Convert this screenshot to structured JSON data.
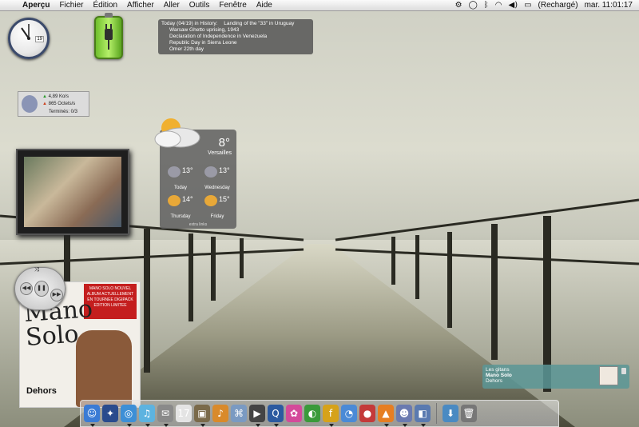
{
  "menubar": {
    "app_name": "Aperçu",
    "items": [
      "Fichier",
      "Édition",
      "Afficher",
      "Aller",
      "Outils",
      "Fenêtre",
      "Aide"
    ],
    "battery_status": "(Rechargé)",
    "clock": "mar. 11:01:17"
  },
  "history_widget": {
    "header": "Today (04/19) in History:",
    "events": [
      "Landing of the \"33\" in Uruguay",
      "Warsaw Ghetto uprising, 1943",
      "Declaration of Independence in Venezuela",
      "Republic Day in Sierra Leone",
      "Omer 22th day"
    ]
  },
  "clock_widget": {
    "date_badge": "19"
  },
  "net_monitor": {
    "download": "4,89 Ko/s",
    "upload": "865 Octets/s",
    "finished": "Terminés: 0/3"
  },
  "weather": {
    "temp": "8°",
    "city": "Versailles",
    "forecast": [
      {
        "temp": "13°",
        "day": "Today",
        "icon": "rain-icon"
      },
      {
        "temp": "13°",
        "day": "Wednesday",
        "icon": "rain-icon"
      },
      {
        "temp": "14°",
        "day": "Thursday",
        "icon": "sun-cloud-icon"
      },
      {
        "temp": "15°",
        "day": "Friday",
        "icon": "sun-cloud-icon"
      }
    ],
    "extra": "extra links"
  },
  "album": {
    "artist": "Mano Solo",
    "title": "Dehors",
    "band_text": "MANO SOLO NOUVEL ALBUM ACTUELLEMENT EN TOURNEE DIGIPACK EDITION LIMITEE"
  },
  "now_playing": {
    "track": "Les gitans",
    "artist": "Mano Solo",
    "album": "Dehors"
  },
  "dock": {
    "items": [
      {
        "name": "finder",
        "glyph": "☺",
        "color": "#3a7bd5"
      },
      {
        "name": "dashboard",
        "glyph": "✦",
        "color": "#2a4b8d"
      },
      {
        "name": "safari",
        "glyph": "◎",
        "color": "#3d8fd6"
      },
      {
        "name": "itunes",
        "glyph": "♫",
        "color": "#5db3e0"
      },
      {
        "name": "mail",
        "glyph": "✉",
        "color": "#8a8a8a"
      },
      {
        "name": "ical",
        "glyph": "17",
        "color": "#e4e4e4"
      },
      {
        "name": "iphoto",
        "glyph": "▣",
        "color": "#7a6a4a"
      },
      {
        "name": "garageband",
        "glyph": "♪",
        "color": "#d98a2a"
      },
      {
        "name": "network",
        "glyph": "⌘",
        "color": "#7a9ac2"
      },
      {
        "name": "imovie",
        "glyph": "▶",
        "color": "#444"
      },
      {
        "name": "quicktime",
        "glyph": "Q",
        "color": "#2c5aa0"
      },
      {
        "name": "flower",
        "glyph": "✿",
        "color": "#d44a9a"
      },
      {
        "name": "dreamweaver",
        "glyph": "◐",
        "color": "#3a9a3a"
      },
      {
        "name": "flash",
        "glyph": "f",
        "color": "#d6a21a"
      },
      {
        "name": "ichat",
        "glyph": "◔",
        "color": "#4a8ad6"
      },
      {
        "name": "colorsync",
        "glyph": "●",
        "color": "#c43a3a"
      },
      {
        "name": "vlc",
        "glyph": "▲",
        "color": "#e67e22"
      },
      {
        "name": "adium",
        "glyph": "☻",
        "color": "#6a7ab0"
      },
      {
        "name": "preview",
        "glyph": "◧",
        "color": "#5a7ab0"
      },
      {
        "name": "downloads",
        "glyph": "⬇",
        "color": "#4a8ac2"
      },
      {
        "name": "trash",
        "glyph": "🗑",
        "color": "#777"
      }
    ]
  }
}
